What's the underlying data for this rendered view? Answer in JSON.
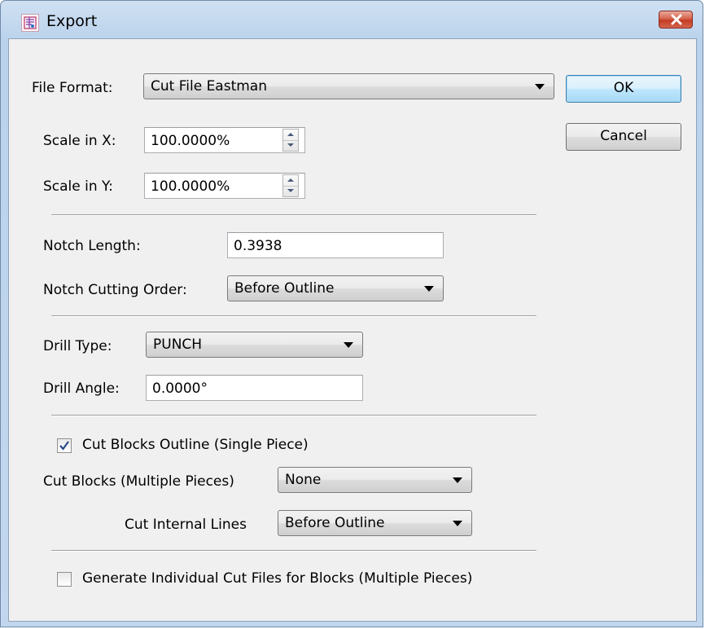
{
  "window": {
    "title": "Export",
    "app_icon": "export-app-icon",
    "close_icon": "close-icon"
  },
  "file_format": {
    "label": "File Format:",
    "value": "Cut File Eastman"
  },
  "buttons": {
    "ok": "OK",
    "cancel": "Cancel"
  },
  "scale": {
    "x_label": "Scale in X:",
    "x_value": "100.0000%",
    "y_label": "Scale in Y:",
    "y_value": "100.0000%"
  },
  "notch": {
    "length_label": "Notch Length:",
    "length_value": "0.3938",
    "order_label": "Notch Cutting Order:",
    "order_value": "Before Outline"
  },
  "drill": {
    "type_label": "Drill Type:",
    "type_value": "PUNCH",
    "angle_label": "Drill Angle:",
    "angle_value": "0.0000°"
  },
  "cut_blocks": {
    "outline_label": "Cut Blocks Outline (Single Piece)",
    "outline_checked": true,
    "multiple_label": "Cut Blocks (Multiple Pieces)",
    "multiple_value": "None",
    "internal_label": "Cut Internal Lines",
    "internal_value": "Before Outline"
  },
  "generate": {
    "label": "Generate Individual Cut Files for Blocks (Multiple Pieces)",
    "checked": false
  },
  "colors": {
    "title_gradient": "#bad2ec",
    "close_red": "#c43a22",
    "default_button": "#3c7fb1",
    "dialog_bg": "#f0f0f0"
  }
}
